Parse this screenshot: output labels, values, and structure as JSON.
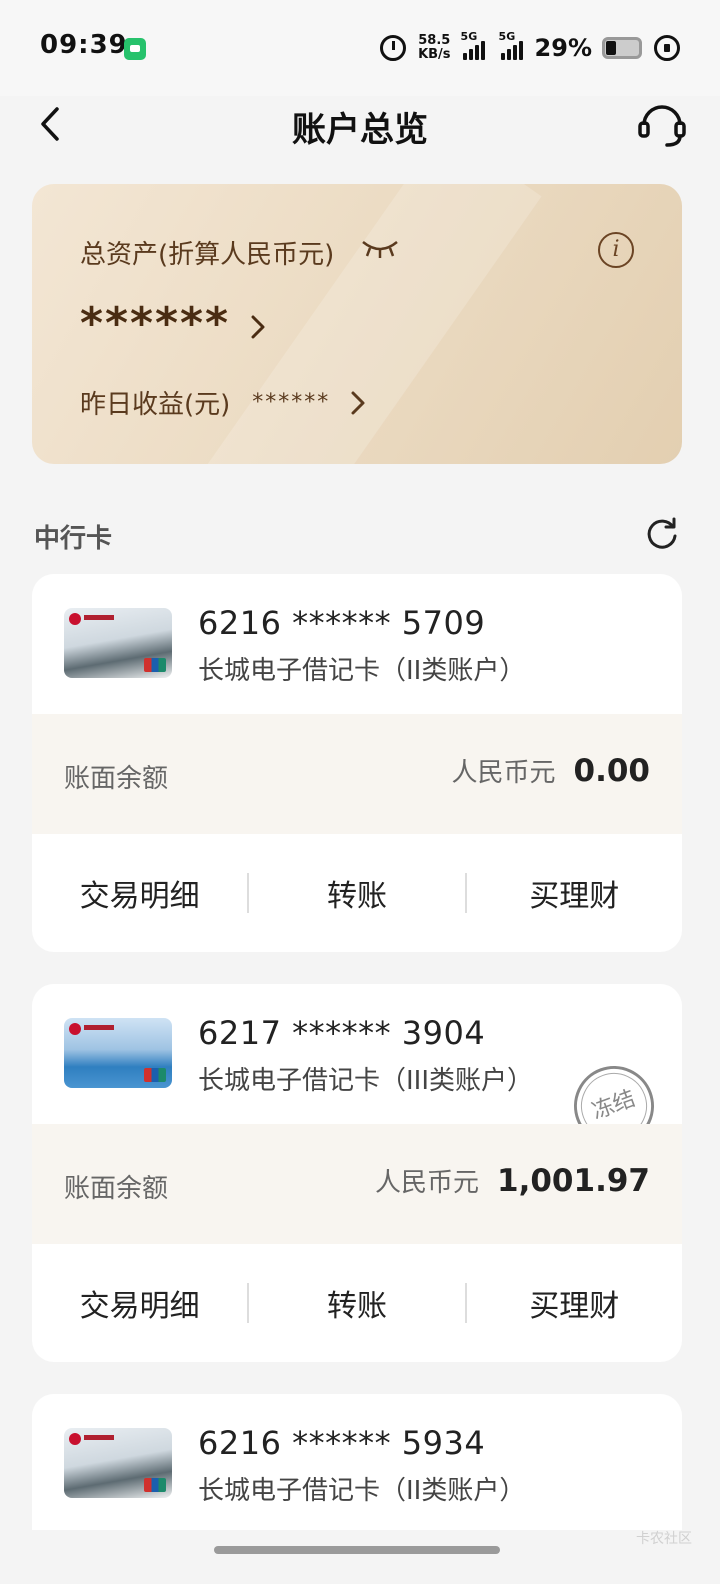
{
  "status_bar": {
    "time": "09:39",
    "net_speed_value": "58.5",
    "net_speed_unit": "KB/s",
    "signal_1_label": "5G",
    "signal_2_label": "5G",
    "battery_percent": "29%"
  },
  "header": {
    "title": "账户总览"
  },
  "assets": {
    "label": "总资产(折算人民币元)",
    "value": "******",
    "yesterday_label": "昨日收益(元)",
    "yesterday_value": "******"
  },
  "section": {
    "title": "中行卡"
  },
  "accounts": [
    {
      "number": "6216 ****** 5709",
      "type": "长城电子借记卡（II类账户）",
      "balance_label": "账面余额",
      "currency": "人民币元",
      "amount": "0.00",
      "frozen": false
    },
    {
      "number": "6217 ****** 3904",
      "type": "长城电子借记卡（III类账户）",
      "balance_label": "账面余额",
      "currency": "人民币元",
      "amount": "1,001.97",
      "frozen": true,
      "frozen_label": "冻结"
    },
    {
      "number": "6216 ****** 5934",
      "type": "长城电子借记卡（II类账户）"
    }
  ],
  "actions": {
    "details": "交易明细",
    "transfer": "转账",
    "wealth": "买理财"
  },
  "watermark": "卡农社区"
}
